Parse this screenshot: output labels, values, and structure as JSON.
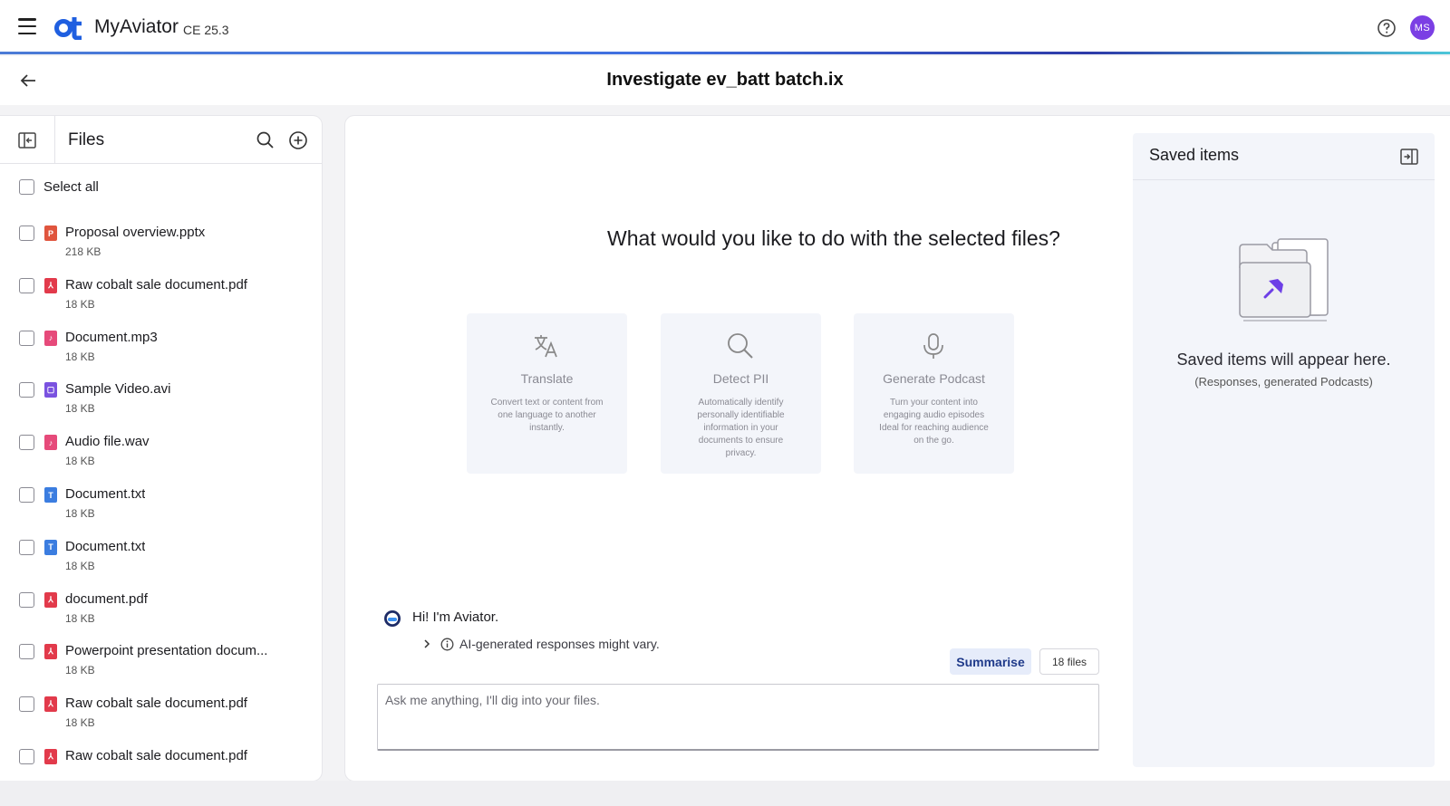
{
  "app": {
    "name": "MyAviator",
    "version": "CE 25.3",
    "user_initials": "MS",
    "accent_color": "#3f6fe0",
    "avatar_color": "#7b3fe4"
  },
  "page": {
    "title": "Investigate ev_batt batch.ix"
  },
  "files_panel": {
    "title": "Files",
    "select_all_label": "Select all",
    "files": [
      {
        "name": "Proposal overview.pptx",
        "size": "218 KB",
        "icon": "pptx-icon",
        "color": "#e0553e",
        "glyph": "P"
      },
      {
        "name": "Raw cobalt sale document.pdf",
        "size": "18 KB",
        "icon": "pdf-icon",
        "color": "#e23a4b",
        "glyph": "⅄"
      },
      {
        "name": "Document.mp3",
        "size": "18 KB",
        "icon": "audio-icon",
        "color": "#e64a7a",
        "glyph": "♪"
      },
      {
        "name": "Sample Video.avi",
        "size": "18 KB",
        "icon": "video-icon",
        "color": "#7a52e0",
        "glyph": "▢"
      },
      {
        "name": "Audio file.wav",
        "size": "18 KB",
        "icon": "audio-icon",
        "color": "#e64a7a",
        "glyph": "♪"
      },
      {
        "name": "Document.txt",
        "size": "18 KB",
        "icon": "text-icon",
        "color": "#3b7de0",
        "glyph": "T"
      },
      {
        "name": "Document.txt",
        "size": "18 KB",
        "icon": "text-icon",
        "color": "#3b7de0",
        "glyph": "T"
      },
      {
        "name": "document.pdf",
        "size": "18 KB",
        "icon": "pdf-icon",
        "color": "#e23a4b",
        "glyph": "⅄"
      },
      {
        "name": "Powerpoint presentation docum...",
        "size": "18 KB",
        "icon": "pdf-icon",
        "color": "#e23a4b",
        "glyph": "⅄"
      },
      {
        "name": "Raw cobalt sale document.pdf",
        "size": "18 KB",
        "icon": "pdf-icon",
        "color": "#e23a4b",
        "glyph": "⅄"
      },
      {
        "name": "Raw cobalt sale document.pdf",
        "size": "",
        "icon": "pdf-icon",
        "color": "#e23a4b",
        "glyph": "⅄"
      }
    ]
  },
  "main": {
    "prompt": "What would you like to do with the selected files?",
    "actions": [
      {
        "title": "Translate",
        "icon": "translate-icon",
        "description": "Convert text or content from one language to another instantly."
      },
      {
        "title": "Detect PII",
        "icon": "search-icon",
        "description": "Automatically identify personally identifiable information in your documents to ensure privacy."
      },
      {
        "title": "Generate Podcast",
        "icon": "microphone-icon",
        "description": "Turn your content into engaging audio episodes Ideal for reaching audience on the go."
      }
    ],
    "greeting": "Hi! I'm Aviator.",
    "disclaimer": "AI-generated responses might vary.",
    "summarise_label": "Summarise",
    "files_count": "18 files",
    "input_placeholder": "Ask me anything, I'll dig into your files."
  },
  "saved": {
    "title": "Saved items",
    "empty_title": "Saved items will appear here.",
    "empty_subtitle": "(Responses, generated Podcasts)"
  }
}
